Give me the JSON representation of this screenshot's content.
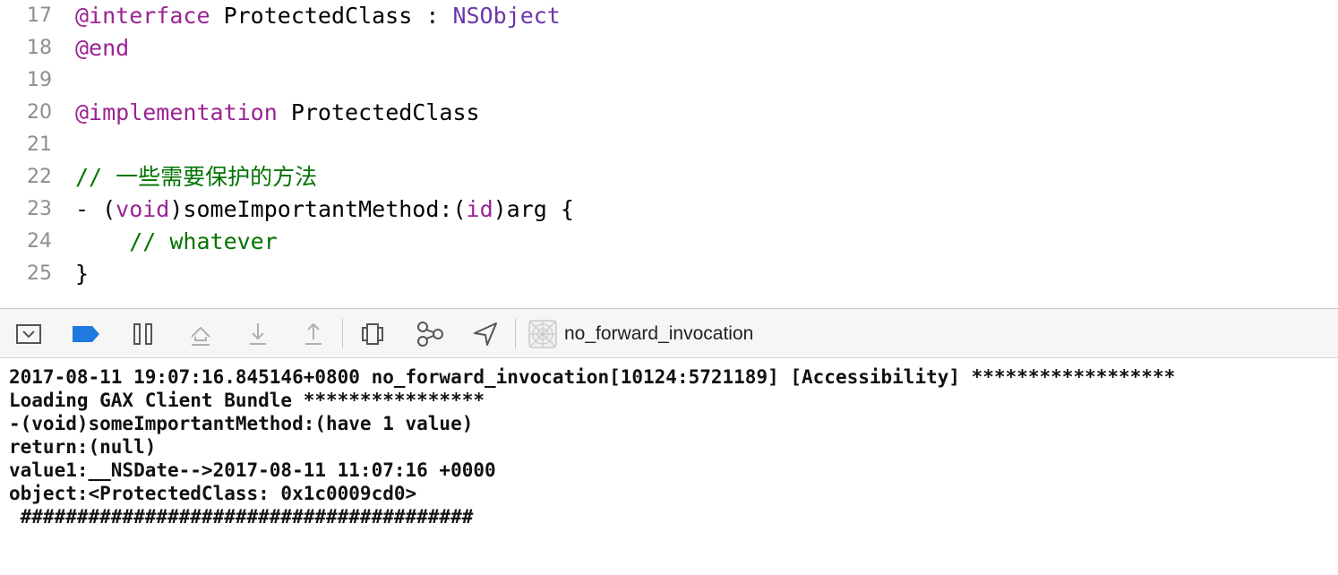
{
  "editor": {
    "lines": [
      {
        "num": "17",
        "segments": [
          {
            "text": "@interface",
            "cls": "kw"
          },
          {
            "text": " ProtectedClass : ",
            "cls": ""
          },
          {
            "text": "NSObject",
            "cls": "cls"
          }
        ]
      },
      {
        "num": "18",
        "segments": [
          {
            "text": "@end",
            "cls": "kw"
          }
        ]
      },
      {
        "num": "19",
        "segments": []
      },
      {
        "num": "20",
        "segments": [
          {
            "text": "@implementation",
            "cls": "kw"
          },
          {
            "text": " ProtectedClass",
            "cls": ""
          }
        ]
      },
      {
        "num": "21",
        "segments": []
      },
      {
        "num": "22",
        "segments": [
          {
            "text": "// 一些需要保护的方法",
            "cls": "cmt"
          }
        ]
      },
      {
        "num": "23",
        "segments": [
          {
            "text": "- (",
            "cls": ""
          },
          {
            "text": "void",
            "cls": "kw"
          },
          {
            "text": ")someImportantMethod:(",
            "cls": ""
          },
          {
            "text": "id",
            "cls": "kw"
          },
          {
            "text": ")arg {",
            "cls": ""
          }
        ]
      },
      {
        "num": "24",
        "segments": [
          {
            "text": "    ",
            "cls": ""
          },
          {
            "text": "// whatever",
            "cls": "cmt"
          }
        ]
      },
      {
        "num": "25",
        "segments": [
          {
            "text": "}",
            "cls": ""
          }
        ]
      }
    ]
  },
  "debug_bar": {
    "buttons": [
      {
        "name": "hide-debug-area-button",
        "icon": "panel-toggle-icon"
      },
      {
        "name": "breakpoints-toggle-button",
        "icon": "breakpoint-icon"
      },
      {
        "name": "pause-continue-button",
        "icon": "pause-icon"
      },
      {
        "name": "step-over-button",
        "icon": "step-over-icon"
      },
      {
        "name": "step-into-button",
        "icon": "step-into-icon"
      },
      {
        "name": "step-out-button",
        "icon": "step-out-icon"
      },
      {
        "name": "debug-view-hierarchy-button",
        "icon": "view-hierarchy-icon"
      },
      {
        "name": "debug-memory-graph-button",
        "icon": "memory-graph-icon"
      },
      {
        "name": "simulate-location-button",
        "icon": "location-arrow-icon"
      }
    ],
    "target_icon": "app-target-icon",
    "target_name": "no_forward_invocation",
    "accent_color": "#1f7ae0"
  },
  "console": {
    "lines": [
      "2017-08-11 19:07:16.845146+0800 no_forward_invocation[10124:5721189] [Accessibility] ******************",
      "Loading GAX Client Bundle ****************",
      "-(void)someImportantMethod:(have 1 value)",
      "return:(null)",
      "value1:__NSDate-->2017-08-11 11:07:16 +0000",
      "object:<ProtectedClass: 0x1c0009cd0>",
      " ########################################"
    ]
  }
}
